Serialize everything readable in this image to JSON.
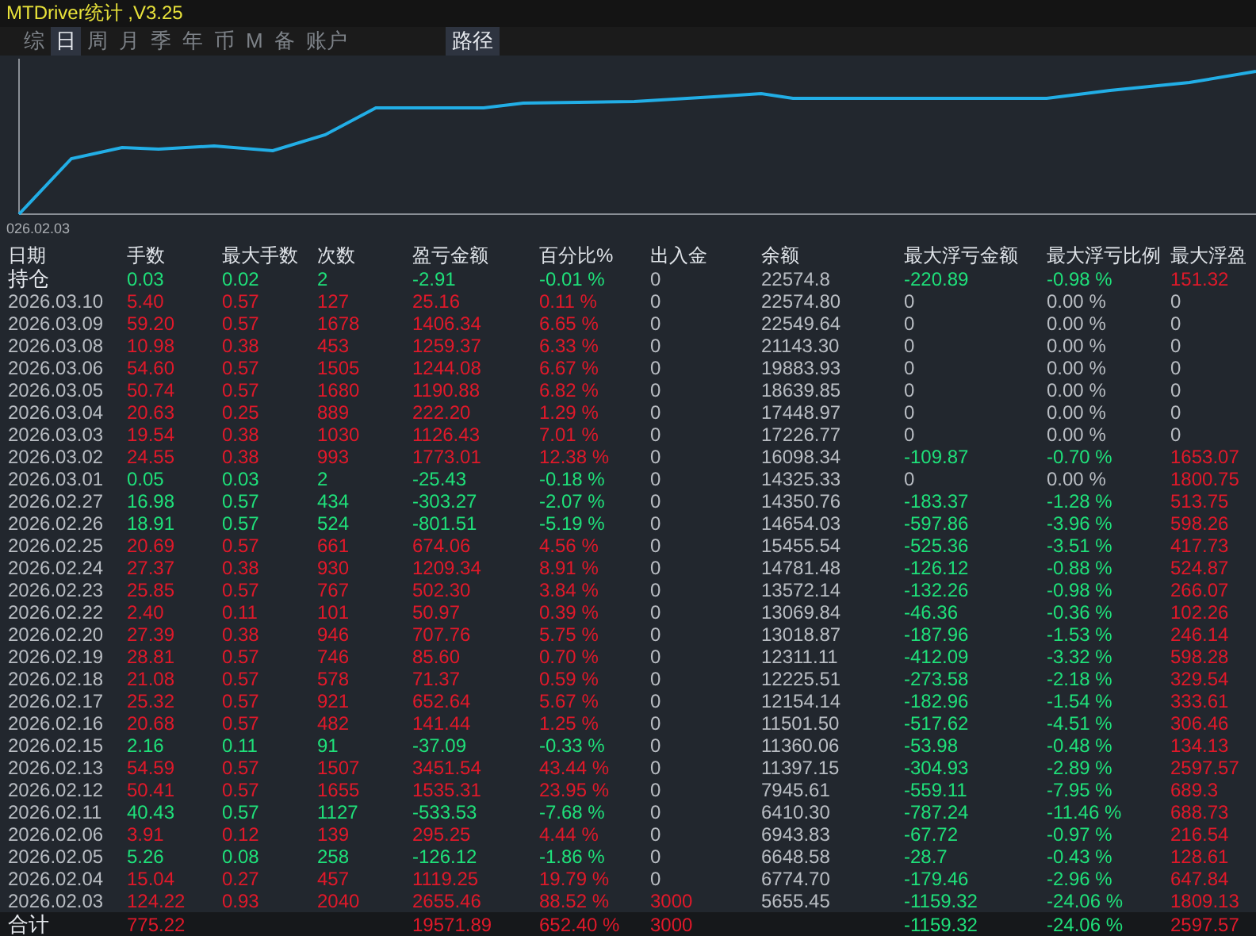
{
  "window": {
    "title": "MTDriver统计 ,V3.25"
  },
  "tabs": [
    {
      "label": "综",
      "selected": false
    },
    {
      "label": "日",
      "selected": true
    },
    {
      "label": "周",
      "selected": false
    },
    {
      "label": "月",
      "selected": false
    },
    {
      "label": "季",
      "selected": false
    },
    {
      "label": "年",
      "selected": false
    },
    {
      "label": "币",
      "selected": false
    },
    {
      "label": "M",
      "selected": false
    },
    {
      "label": "备",
      "selected": false
    },
    {
      "label": "账户",
      "selected": false
    }
  ],
  "path_button": {
    "label": "路径",
    "selected": true
  },
  "chart": {
    "start_label": "026.02.03"
  },
  "table": {
    "columns": [
      "日期",
      "手数",
      "最大手数",
      "次数",
      "盈亏金额",
      "百分比%",
      "出入金",
      "余额",
      "最大浮亏金额",
      "最大浮亏比例",
      "最大浮盈"
    ],
    "rows": [
      {
        "kind": "summary",
        "cells": [
          {
            "text": "持仓",
            "color": "#e6e9ee"
          },
          {
            "text": "0.03",
            "color": "#1fe07a"
          },
          {
            "text": "0.02",
            "color": "#1fe07a"
          },
          {
            "text": "2",
            "color": "#1fe07a"
          },
          {
            "text": "-2.91",
            "color": "#1fe07a"
          },
          {
            "text": "-0.01 %",
            "color": "#1fe07a"
          },
          {
            "text": "0",
            "color": "#b9bdc3"
          },
          {
            "text": "22574.8",
            "color": "#b9bdc3"
          },
          {
            "text": "-220.89",
            "color": "#1fe07a"
          },
          {
            "text": "-0.98 %",
            "color": "#1fe07a"
          },
          {
            "text": "151.32",
            "color": "#e0192a"
          }
        ]
      },
      {
        "kind": "day",
        "cells": [
          {
            "text": "2026.03.10",
            "color": "#b9bdc3"
          },
          {
            "text": "5.40",
            "color": "#e0192a"
          },
          {
            "text": "0.57",
            "color": "#e0192a"
          },
          {
            "text": "127",
            "color": "#e0192a"
          },
          {
            "text": "25.16",
            "color": "#e0192a"
          },
          {
            "text": "0.11 %",
            "color": "#e0192a"
          },
          {
            "text": "0",
            "color": "#b9bdc3"
          },
          {
            "text": "22574.80",
            "color": "#b9bdc3"
          },
          {
            "text": "0",
            "color": "#b9bdc3"
          },
          {
            "text": "0.00 %",
            "color": "#b9bdc3"
          },
          {
            "text": "0",
            "color": "#b9bdc3"
          }
        ]
      },
      {
        "kind": "day",
        "cells": [
          {
            "text": "2026.03.09",
            "color": "#b9bdc3"
          },
          {
            "text": "59.20",
            "color": "#e0192a"
          },
          {
            "text": "0.57",
            "color": "#e0192a"
          },
          {
            "text": "1678",
            "color": "#e0192a"
          },
          {
            "text": "1406.34",
            "color": "#e0192a"
          },
          {
            "text": "6.65 %",
            "color": "#e0192a"
          },
          {
            "text": "0",
            "color": "#b9bdc3"
          },
          {
            "text": "22549.64",
            "color": "#b9bdc3"
          },
          {
            "text": "0",
            "color": "#b9bdc3"
          },
          {
            "text": "0.00 %",
            "color": "#b9bdc3"
          },
          {
            "text": "0",
            "color": "#b9bdc3"
          }
        ]
      },
      {
        "kind": "day",
        "cells": [
          {
            "text": "2026.03.08",
            "color": "#b9bdc3"
          },
          {
            "text": "10.98",
            "color": "#e0192a"
          },
          {
            "text": "0.38",
            "color": "#e0192a"
          },
          {
            "text": "453",
            "color": "#e0192a"
          },
          {
            "text": "1259.37",
            "color": "#e0192a"
          },
          {
            "text": "6.33 %",
            "color": "#e0192a"
          },
          {
            "text": "0",
            "color": "#b9bdc3"
          },
          {
            "text": "21143.30",
            "color": "#b9bdc3"
          },
          {
            "text": "0",
            "color": "#b9bdc3"
          },
          {
            "text": "0.00 %",
            "color": "#b9bdc3"
          },
          {
            "text": "0",
            "color": "#b9bdc3"
          }
        ]
      },
      {
        "kind": "day",
        "cells": [
          {
            "text": "2026.03.06",
            "color": "#b9bdc3"
          },
          {
            "text": "54.60",
            "color": "#e0192a"
          },
          {
            "text": "0.57",
            "color": "#e0192a"
          },
          {
            "text": "1505",
            "color": "#e0192a"
          },
          {
            "text": "1244.08",
            "color": "#e0192a"
          },
          {
            "text": "6.67 %",
            "color": "#e0192a"
          },
          {
            "text": "0",
            "color": "#b9bdc3"
          },
          {
            "text": "19883.93",
            "color": "#b9bdc3"
          },
          {
            "text": "0",
            "color": "#b9bdc3"
          },
          {
            "text": "0.00 %",
            "color": "#b9bdc3"
          },
          {
            "text": "0",
            "color": "#b9bdc3"
          }
        ]
      },
      {
        "kind": "day",
        "cells": [
          {
            "text": "2026.03.05",
            "color": "#b9bdc3"
          },
          {
            "text": "50.74",
            "color": "#e0192a"
          },
          {
            "text": "0.57",
            "color": "#e0192a"
          },
          {
            "text": "1680",
            "color": "#e0192a"
          },
          {
            "text": "1190.88",
            "color": "#e0192a"
          },
          {
            "text": "6.82 %",
            "color": "#e0192a"
          },
          {
            "text": "0",
            "color": "#b9bdc3"
          },
          {
            "text": "18639.85",
            "color": "#b9bdc3"
          },
          {
            "text": "0",
            "color": "#b9bdc3"
          },
          {
            "text": "0.00 %",
            "color": "#b9bdc3"
          },
          {
            "text": "0",
            "color": "#b9bdc3"
          }
        ]
      },
      {
        "kind": "day",
        "cells": [
          {
            "text": "2026.03.04",
            "color": "#b9bdc3"
          },
          {
            "text": "20.63",
            "color": "#e0192a"
          },
          {
            "text": "0.25",
            "color": "#e0192a"
          },
          {
            "text": "889",
            "color": "#e0192a"
          },
          {
            "text": "222.20",
            "color": "#e0192a"
          },
          {
            "text": "1.29 %",
            "color": "#e0192a"
          },
          {
            "text": "0",
            "color": "#b9bdc3"
          },
          {
            "text": "17448.97",
            "color": "#b9bdc3"
          },
          {
            "text": "0",
            "color": "#b9bdc3"
          },
          {
            "text": "0.00 %",
            "color": "#b9bdc3"
          },
          {
            "text": "0",
            "color": "#b9bdc3"
          }
        ]
      },
      {
        "kind": "day",
        "cells": [
          {
            "text": "2026.03.03",
            "color": "#b9bdc3"
          },
          {
            "text": "19.54",
            "color": "#e0192a"
          },
          {
            "text": "0.38",
            "color": "#e0192a"
          },
          {
            "text": "1030",
            "color": "#e0192a"
          },
          {
            "text": "1126.43",
            "color": "#e0192a"
          },
          {
            "text": "7.01 %",
            "color": "#e0192a"
          },
          {
            "text": "0",
            "color": "#b9bdc3"
          },
          {
            "text": "17226.77",
            "color": "#b9bdc3"
          },
          {
            "text": "0",
            "color": "#b9bdc3"
          },
          {
            "text": "0.00 %",
            "color": "#b9bdc3"
          },
          {
            "text": "0",
            "color": "#b9bdc3"
          }
        ]
      },
      {
        "kind": "day",
        "cells": [
          {
            "text": "2026.03.02",
            "color": "#b9bdc3"
          },
          {
            "text": "24.55",
            "color": "#e0192a"
          },
          {
            "text": "0.38",
            "color": "#e0192a"
          },
          {
            "text": "993",
            "color": "#e0192a"
          },
          {
            "text": "1773.01",
            "color": "#e0192a"
          },
          {
            "text": "12.38 %",
            "color": "#e0192a"
          },
          {
            "text": "0",
            "color": "#b9bdc3"
          },
          {
            "text": "16098.34",
            "color": "#b9bdc3"
          },
          {
            "text": "-109.87",
            "color": "#1fe07a"
          },
          {
            "text": "-0.70 %",
            "color": "#1fe07a"
          },
          {
            "text": "1653.07",
            "color": "#e0192a"
          }
        ]
      },
      {
        "kind": "day",
        "cells": [
          {
            "text": "2026.03.01",
            "color": "#b9bdc3"
          },
          {
            "text": "0.05",
            "color": "#1fe07a"
          },
          {
            "text": "0.03",
            "color": "#1fe07a"
          },
          {
            "text": "2",
            "color": "#1fe07a"
          },
          {
            "text": "-25.43",
            "color": "#1fe07a"
          },
          {
            "text": "-0.18 %",
            "color": "#1fe07a"
          },
          {
            "text": "0",
            "color": "#b9bdc3"
          },
          {
            "text": "14325.33",
            "color": "#b9bdc3"
          },
          {
            "text": "0",
            "color": "#b9bdc3"
          },
          {
            "text": "0.00 %",
            "color": "#b9bdc3"
          },
          {
            "text": "1800.75",
            "color": "#e0192a"
          }
        ]
      },
      {
        "kind": "day",
        "cells": [
          {
            "text": "2026.02.27",
            "color": "#b9bdc3"
          },
          {
            "text": "16.98",
            "color": "#1fe07a"
          },
          {
            "text": "0.57",
            "color": "#1fe07a"
          },
          {
            "text": "434",
            "color": "#1fe07a"
          },
          {
            "text": "-303.27",
            "color": "#1fe07a"
          },
          {
            "text": "-2.07 %",
            "color": "#1fe07a"
          },
          {
            "text": "0",
            "color": "#b9bdc3"
          },
          {
            "text": "14350.76",
            "color": "#b9bdc3"
          },
          {
            "text": "-183.37",
            "color": "#1fe07a"
          },
          {
            "text": "-1.28 %",
            "color": "#1fe07a"
          },
          {
            "text": "513.75",
            "color": "#e0192a"
          }
        ]
      },
      {
        "kind": "day",
        "cells": [
          {
            "text": "2026.02.26",
            "color": "#b9bdc3"
          },
          {
            "text": "18.91",
            "color": "#1fe07a"
          },
          {
            "text": "0.57",
            "color": "#1fe07a"
          },
          {
            "text": "524",
            "color": "#1fe07a"
          },
          {
            "text": "-801.51",
            "color": "#1fe07a"
          },
          {
            "text": "-5.19 %",
            "color": "#1fe07a"
          },
          {
            "text": "0",
            "color": "#b9bdc3"
          },
          {
            "text": "14654.03",
            "color": "#b9bdc3"
          },
          {
            "text": "-597.86",
            "color": "#1fe07a"
          },
          {
            "text": "-3.96 %",
            "color": "#1fe07a"
          },
          {
            "text": "598.26",
            "color": "#e0192a"
          }
        ]
      },
      {
        "kind": "day",
        "cells": [
          {
            "text": "2026.02.25",
            "color": "#b9bdc3"
          },
          {
            "text": "20.69",
            "color": "#e0192a"
          },
          {
            "text": "0.57",
            "color": "#e0192a"
          },
          {
            "text": "661",
            "color": "#e0192a"
          },
          {
            "text": "674.06",
            "color": "#e0192a"
          },
          {
            "text": "4.56 %",
            "color": "#e0192a"
          },
          {
            "text": "0",
            "color": "#b9bdc3"
          },
          {
            "text": "15455.54",
            "color": "#b9bdc3"
          },
          {
            "text": "-525.36",
            "color": "#1fe07a"
          },
          {
            "text": "-3.51 %",
            "color": "#1fe07a"
          },
          {
            "text": "417.73",
            "color": "#e0192a"
          }
        ]
      },
      {
        "kind": "day",
        "cells": [
          {
            "text": "2026.02.24",
            "color": "#b9bdc3"
          },
          {
            "text": "27.37",
            "color": "#e0192a"
          },
          {
            "text": "0.38",
            "color": "#e0192a"
          },
          {
            "text": "930",
            "color": "#e0192a"
          },
          {
            "text": "1209.34",
            "color": "#e0192a"
          },
          {
            "text": "8.91 %",
            "color": "#e0192a"
          },
          {
            "text": "0",
            "color": "#b9bdc3"
          },
          {
            "text": "14781.48",
            "color": "#b9bdc3"
          },
          {
            "text": "-126.12",
            "color": "#1fe07a"
          },
          {
            "text": "-0.88 %",
            "color": "#1fe07a"
          },
          {
            "text": "524.87",
            "color": "#e0192a"
          }
        ]
      },
      {
        "kind": "day",
        "cells": [
          {
            "text": "2026.02.23",
            "color": "#b9bdc3"
          },
          {
            "text": "25.85",
            "color": "#e0192a"
          },
          {
            "text": "0.57",
            "color": "#e0192a"
          },
          {
            "text": "767",
            "color": "#e0192a"
          },
          {
            "text": "502.30",
            "color": "#e0192a"
          },
          {
            "text": "3.84 %",
            "color": "#e0192a"
          },
          {
            "text": "0",
            "color": "#b9bdc3"
          },
          {
            "text": "13572.14",
            "color": "#b9bdc3"
          },
          {
            "text": "-132.26",
            "color": "#1fe07a"
          },
          {
            "text": "-0.98 %",
            "color": "#1fe07a"
          },
          {
            "text": "266.07",
            "color": "#e0192a"
          }
        ]
      },
      {
        "kind": "day",
        "cells": [
          {
            "text": "2026.02.22",
            "color": "#b9bdc3"
          },
          {
            "text": "2.40",
            "color": "#e0192a"
          },
          {
            "text": "0.11",
            "color": "#e0192a"
          },
          {
            "text": "101",
            "color": "#e0192a"
          },
          {
            "text": "50.97",
            "color": "#e0192a"
          },
          {
            "text": "0.39 %",
            "color": "#e0192a"
          },
          {
            "text": "0",
            "color": "#b9bdc3"
          },
          {
            "text": "13069.84",
            "color": "#b9bdc3"
          },
          {
            "text": "-46.36",
            "color": "#1fe07a"
          },
          {
            "text": "-0.36 %",
            "color": "#1fe07a"
          },
          {
            "text": "102.26",
            "color": "#e0192a"
          }
        ]
      },
      {
        "kind": "day",
        "cells": [
          {
            "text": "2026.02.20",
            "color": "#b9bdc3"
          },
          {
            "text": "27.39",
            "color": "#e0192a"
          },
          {
            "text": "0.38",
            "color": "#e0192a"
          },
          {
            "text": "946",
            "color": "#e0192a"
          },
          {
            "text": "707.76",
            "color": "#e0192a"
          },
          {
            "text": "5.75 %",
            "color": "#e0192a"
          },
          {
            "text": "0",
            "color": "#b9bdc3"
          },
          {
            "text": "13018.87",
            "color": "#b9bdc3"
          },
          {
            "text": "-187.96",
            "color": "#1fe07a"
          },
          {
            "text": "-1.53 %",
            "color": "#1fe07a"
          },
          {
            "text": "246.14",
            "color": "#e0192a"
          }
        ]
      },
      {
        "kind": "day",
        "cells": [
          {
            "text": "2026.02.19",
            "color": "#b9bdc3"
          },
          {
            "text": "28.81",
            "color": "#e0192a"
          },
          {
            "text": "0.57",
            "color": "#e0192a"
          },
          {
            "text": "746",
            "color": "#e0192a"
          },
          {
            "text": "85.60",
            "color": "#e0192a"
          },
          {
            "text": "0.70 %",
            "color": "#e0192a"
          },
          {
            "text": "0",
            "color": "#b9bdc3"
          },
          {
            "text": "12311.11",
            "color": "#b9bdc3"
          },
          {
            "text": "-412.09",
            "color": "#1fe07a"
          },
          {
            "text": "-3.32 %",
            "color": "#1fe07a"
          },
          {
            "text": "598.28",
            "color": "#e0192a"
          }
        ]
      },
      {
        "kind": "day",
        "cells": [
          {
            "text": "2026.02.18",
            "color": "#b9bdc3"
          },
          {
            "text": "21.08",
            "color": "#e0192a"
          },
          {
            "text": "0.57",
            "color": "#e0192a"
          },
          {
            "text": "578",
            "color": "#e0192a"
          },
          {
            "text": "71.37",
            "color": "#e0192a"
          },
          {
            "text": "0.59 %",
            "color": "#e0192a"
          },
          {
            "text": "0",
            "color": "#b9bdc3"
          },
          {
            "text": "12225.51",
            "color": "#b9bdc3"
          },
          {
            "text": "-273.58",
            "color": "#1fe07a"
          },
          {
            "text": "-2.18 %",
            "color": "#1fe07a"
          },
          {
            "text": "329.54",
            "color": "#e0192a"
          }
        ]
      },
      {
        "kind": "day",
        "cells": [
          {
            "text": "2026.02.17",
            "color": "#b9bdc3"
          },
          {
            "text": "25.32",
            "color": "#e0192a"
          },
          {
            "text": "0.57",
            "color": "#e0192a"
          },
          {
            "text": "921",
            "color": "#e0192a"
          },
          {
            "text": "652.64",
            "color": "#e0192a"
          },
          {
            "text": "5.67 %",
            "color": "#e0192a"
          },
          {
            "text": "0",
            "color": "#b9bdc3"
          },
          {
            "text": "12154.14",
            "color": "#b9bdc3"
          },
          {
            "text": "-182.96",
            "color": "#1fe07a"
          },
          {
            "text": "-1.54 %",
            "color": "#1fe07a"
          },
          {
            "text": "333.61",
            "color": "#e0192a"
          }
        ]
      },
      {
        "kind": "day",
        "cells": [
          {
            "text": "2026.02.16",
            "color": "#b9bdc3"
          },
          {
            "text": "20.68",
            "color": "#e0192a"
          },
          {
            "text": "0.57",
            "color": "#e0192a"
          },
          {
            "text": "482",
            "color": "#e0192a"
          },
          {
            "text": "141.44",
            "color": "#e0192a"
          },
          {
            "text": "1.25 %",
            "color": "#e0192a"
          },
          {
            "text": "0",
            "color": "#b9bdc3"
          },
          {
            "text": "11501.50",
            "color": "#b9bdc3"
          },
          {
            "text": "-517.62",
            "color": "#1fe07a"
          },
          {
            "text": "-4.51 %",
            "color": "#1fe07a"
          },
          {
            "text": "306.46",
            "color": "#e0192a"
          }
        ]
      },
      {
        "kind": "day",
        "cells": [
          {
            "text": "2026.02.15",
            "color": "#b9bdc3"
          },
          {
            "text": "2.16",
            "color": "#1fe07a"
          },
          {
            "text": "0.11",
            "color": "#1fe07a"
          },
          {
            "text": "91",
            "color": "#1fe07a"
          },
          {
            "text": "-37.09",
            "color": "#1fe07a"
          },
          {
            "text": "-0.33 %",
            "color": "#1fe07a"
          },
          {
            "text": "0",
            "color": "#b9bdc3"
          },
          {
            "text": "11360.06",
            "color": "#b9bdc3"
          },
          {
            "text": "-53.98",
            "color": "#1fe07a"
          },
          {
            "text": "-0.48 %",
            "color": "#1fe07a"
          },
          {
            "text": "134.13",
            "color": "#e0192a"
          }
        ]
      },
      {
        "kind": "day",
        "cells": [
          {
            "text": "2026.02.13",
            "color": "#b9bdc3"
          },
          {
            "text": "54.59",
            "color": "#e0192a"
          },
          {
            "text": "0.57",
            "color": "#e0192a"
          },
          {
            "text": "1507",
            "color": "#e0192a"
          },
          {
            "text": "3451.54",
            "color": "#e0192a"
          },
          {
            "text": "43.44 %",
            "color": "#e0192a"
          },
          {
            "text": "0",
            "color": "#b9bdc3"
          },
          {
            "text": "11397.15",
            "color": "#b9bdc3"
          },
          {
            "text": "-304.93",
            "color": "#1fe07a"
          },
          {
            "text": "-2.89 %",
            "color": "#1fe07a"
          },
          {
            "text": "2597.57",
            "color": "#e0192a"
          }
        ]
      },
      {
        "kind": "day",
        "cells": [
          {
            "text": "2026.02.12",
            "color": "#b9bdc3"
          },
          {
            "text": "50.41",
            "color": "#e0192a"
          },
          {
            "text": "0.57",
            "color": "#e0192a"
          },
          {
            "text": "1655",
            "color": "#e0192a"
          },
          {
            "text": "1535.31",
            "color": "#e0192a"
          },
          {
            "text": "23.95 %",
            "color": "#e0192a"
          },
          {
            "text": "0",
            "color": "#b9bdc3"
          },
          {
            "text": "7945.61",
            "color": "#b9bdc3"
          },
          {
            "text": "-559.11",
            "color": "#1fe07a"
          },
          {
            "text": "-7.95 %",
            "color": "#1fe07a"
          },
          {
            "text": "689.3",
            "color": "#e0192a"
          }
        ]
      },
      {
        "kind": "day",
        "cells": [
          {
            "text": "2026.02.11",
            "color": "#b9bdc3"
          },
          {
            "text": "40.43",
            "color": "#1fe07a"
          },
          {
            "text": "0.57",
            "color": "#1fe07a"
          },
          {
            "text": "1127",
            "color": "#1fe07a"
          },
          {
            "text": "-533.53",
            "color": "#1fe07a"
          },
          {
            "text": "-7.68 %",
            "color": "#1fe07a"
          },
          {
            "text": "0",
            "color": "#b9bdc3"
          },
          {
            "text": "6410.30",
            "color": "#b9bdc3"
          },
          {
            "text": "-787.24",
            "color": "#1fe07a"
          },
          {
            "text": "-11.46 %",
            "color": "#1fe07a"
          },
          {
            "text": "688.73",
            "color": "#e0192a"
          }
        ]
      },
      {
        "kind": "day",
        "cells": [
          {
            "text": "2026.02.06",
            "color": "#b9bdc3"
          },
          {
            "text": "3.91",
            "color": "#e0192a"
          },
          {
            "text": "0.12",
            "color": "#e0192a"
          },
          {
            "text": "139",
            "color": "#e0192a"
          },
          {
            "text": "295.25",
            "color": "#e0192a"
          },
          {
            "text": "4.44 %",
            "color": "#e0192a"
          },
          {
            "text": "0",
            "color": "#b9bdc3"
          },
          {
            "text": "6943.83",
            "color": "#b9bdc3"
          },
          {
            "text": "-67.72",
            "color": "#1fe07a"
          },
          {
            "text": "-0.97 %",
            "color": "#1fe07a"
          },
          {
            "text": "216.54",
            "color": "#e0192a"
          }
        ]
      },
      {
        "kind": "day",
        "cells": [
          {
            "text": "2026.02.05",
            "color": "#b9bdc3"
          },
          {
            "text": "5.26",
            "color": "#1fe07a"
          },
          {
            "text": "0.08",
            "color": "#1fe07a"
          },
          {
            "text": "258",
            "color": "#1fe07a"
          },
          {
            "text": "-126.12",
            "color": "#1fe07a"
          },
          {
            "text": "-1.86 %",
            "color": "#1fe07a"
          },
          {
            "text": "0",
            "color": "#b9bdc3"
          },
          {
            "text": "6648.58",
            "color": "#b9bdc3"
          },
          {
            "text": "-28.7",
            "color": "#1fe07a"
          },
          {
            "text": "-0.43 %",
            "color": "#1fe07a"
          },
          {
            "text": "128.61",
            "color": "#e0192a"
          }
        ]
      },
      {
        "kind": "day",
        "cells": [
          {
            "text": "2026.02.04",
            "color": "#b9bdc3"
          },
          {
            "text": "15.04",
            "color": "#e0192a"
          },
          {
            "text": "0.27",
            "color": "#e0192a"
          },
          {
            "text": "457",
            "color": "#e0192a"
          },
          {
            "text": "1119.25",
            "color": "#e0192a"
          },
          {
            "text": "19.79 %",
            "color": "#e0192a"
          },
          {
            "text": "0",
            "color": "#b9bdc3"
          },
          {
            "text": "6774.70",
            "color": "#b9bdc3"
          },
          {
            "text": "-179.46",
            "color": "#1fe07a"
          },
          {
            "text": "-2.96 %",
            "color": "#1fe07a"
          },
          {
            "text": "647.84",
            "color": "#e0192a"
          }
        ]
      },
      {
        "kind": "day",
        "cells": [
          {
            "text": "2026.02.03",
            "color": "#b9bdc3"
          },
          {
            "text": "124.22",
            "color": "#e0192a"
          },
          {
            "text": "0.93",
            "color": "#e0192a"
          },
          {
            "text": "2040",
            "color": "#e0192a"
          },
          {
            "text": "2655.46",
            "color": "#e0192a"
          },
          {
            "text": "88.52 %",
            "color": "#e0192a"
          },
          {
            "text": "3000",
            "color": "#e0192a"
          },
          {
            "text": "5655.45",
            "color": "#b9bdc3"
          },
          {
            "text": "-1159.32",
            "color": "#1fe07a"
          },
          {
            "text": "-24.06 %",
            "color": "#1fe07a"
          },
          {
            "text": "1809.13",
            "color": "#e0192a"
          }
        ]
      },
      {
        "kind": "total",
        "cells": [
          {
            "text": "合计",
            "color": "#e6e9ee"
          },
          {
            "text": "775.22",
            "color": "#e0192a"
          },
          null,
          null,
          {
            "text": "19571.89",
            "color": "#e0192a"
          },
          {
            "text": "652.40 %",
            "color": "#e0192a"
          },
          {
            "text": "3000",
            "color": "#e0192a"
          },
          null,
          {
            "text": "-1159.32",
            "color": "#1fe07a"
          },
          {
            "text": "-24.06 %",
            "color": "#1fe07a"
          },
          {
            "text": "2597.57",
            "color": "#e0192a"
          }
        ]
      }
    ]
  }
}
